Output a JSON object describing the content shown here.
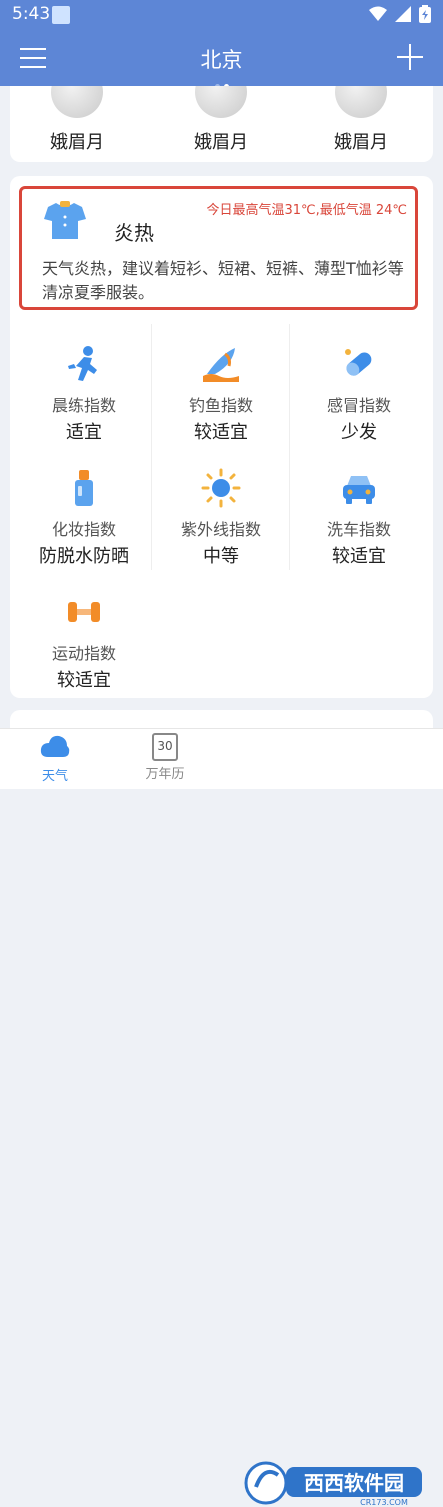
{
  "status_bar": {
    "time": "5:43"
  },
  "header": {
    "city": "北京"
  },
  "moon_phases": [
    {
      "label": "娥眉月"
    },
    {
      "label": "娥眉月"
    },
    {
      "label": "娥眉月"
    }
  ],
  "tip": {
    "title": "炎热",
    "temperature": "今日最高气温31℃,最低气温 24℃",
    "text": "天气炎热，建议着短衫、短裙、短裤、薄型T恤衫等清凉夏季服装。"
  },
  "indices": [
    {
      "label": "晨练指数",
      "value": "适宜",
      "icon": "running-icon"
    },
    {
      "label": "钓鱼指数",
      "value": "较适宜",
      "icon": "fishing-icon"
    },
    {
      "label": "感冒指数",
      "value": "少发",
      "icon": "pill-icon"
    },
    {
      "label": "化妆指数",
      "value": "防脱水防晒",
      "icon": "cosmetics-icon"
    },
    {
      "label": "紫外线指数",
      "value": "中等",
      "icon": "sun-icon"
    },
    {
      "label": "洗车指数",
      "value": "较适宜",
      "icon": "car-icon"
    },
    {
      "label": "运动指数",
      "value": "较适宜",
      "icon": "dumbbell-icon"
    }
  ],
  "tabs": [
    {
      "label": "天气",
      "active": true
    },
    {
      "label": "万年历",
      "active": false,
      "calendar_number": "30"
    }
  ],
  "watermark": {
    "text": "西西软件园",
    "subtext": "CR173.COM"
  },
  "colors": {
    "header": "#5d86d6",
    "accent": "#3d8de8",
    "alert": "#d9463a"
  }
}
